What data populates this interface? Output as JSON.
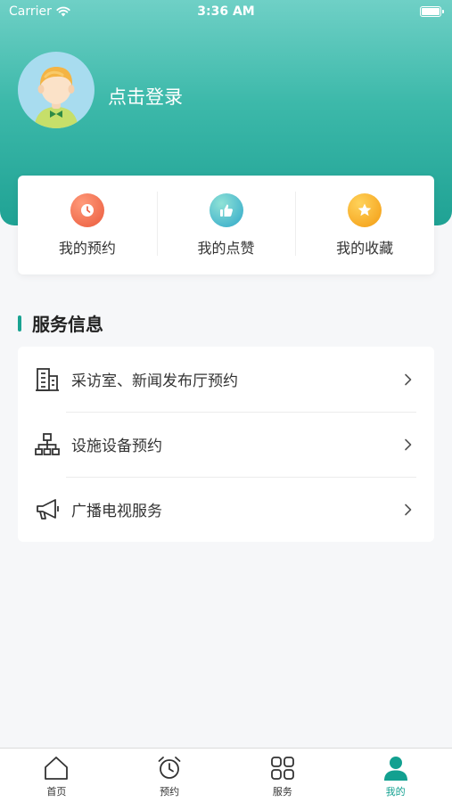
{
  "status_bar": {
    "carrier": "Carrier",
    "time": "3:36 AM"
  },
  "profile": {
    "login_label": "点击登录"
  },
  "quick_actions": [
    {
      "label": "我的预约",
      "icon": "clock-icon"
    },
    {
      "label": "我的点赞",
      "icon": "thumbs-up-icon"
    },
    {
      "label": "我的收藏",
      "icon": "star-icon"
    }
  ],
  "services": {
    "title": "服务信息",
    "items": [
      {
        "label": "采访室、新闻发布厅预约",
        "icon": "building-icon"
      },
      {
        "label": "设施设备预约",
        "icon": "network-icon"
      },
      {
        "label": "广播电视服务",
        "icon": "megaphone-icon"
      }
    ]
  },
  "tabbar": {
    "active": "我的",
    "tabs": [
      {
        "label": "首页",
        "icon": "home-icon"
      },
      {
        "label": "预约",
        "icon": "alarm-clock-icon"
      },
      {
        "label": "服务",
        "icon": "grid-icon"
      },
      {
        "label": "我的",
        "icon": "person-icon"
      }
    ]
  },
  "colors": {
    "accent": "#1aa392",
    "hero_top": "#6fd0c6",
    "hero_bottom": "#1fa294"
  }
}
